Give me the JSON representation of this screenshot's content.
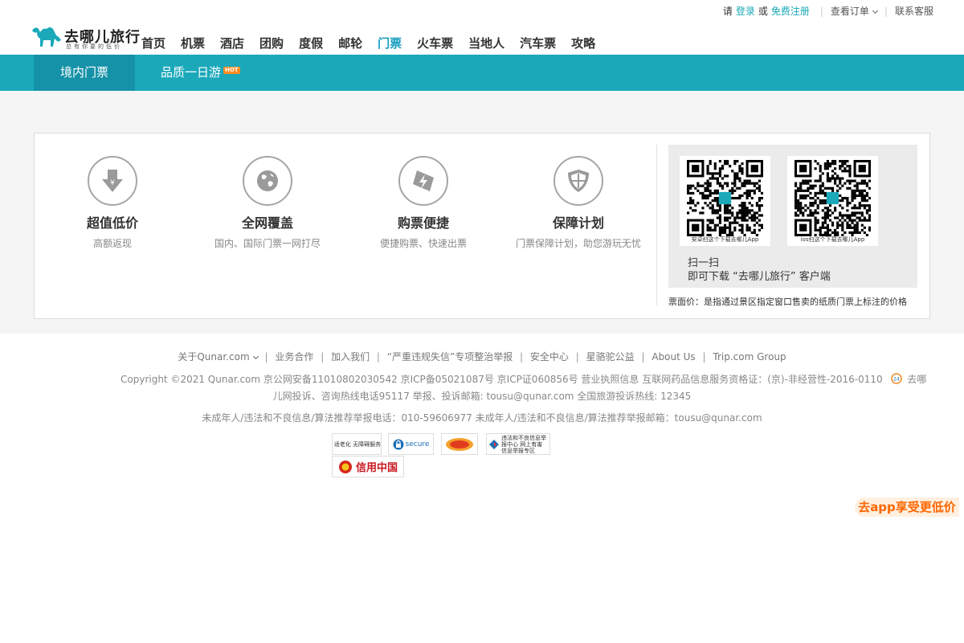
{
  "logo": {
    "name": "去哪儿旅行",
    "slogan": "总有你要的低价"
  },
  "main_nav": [
    "首页",
    "机票",
    "酒店",
    "团购",
    "度假",
    "邮轮",
    "门票",
    "火车票",
    "当地人",
    "汽车票",
    "攻略"
  ],
  "active_nav": "门票",
  "userbar": {
    "prefix": "请",
    "login": "登录",
    "or": "或",
    "register": "免费注册",
    "orders": "查看订单",
    "service": "联系客服"
  },
  "subnav": {
    "tab1": "境内门票",
    "tab2": "品质一日游",
    "tab2_badge": "HOT"
  },
  "features": [
    {
      "title": "超值低价",
      "desc": "高额返现",
      "icon": "yen-down-arrow-icon"
    },
    {
      "title": "全网覆盖",
      "desc": "国内、国际门票一网打尽",
      "icon": "globe-icon"
    },
    {
      "title": "购票便捷",
      "desc": "便捷购票、快速出票",
      "icon": "ticket-lightning-icon"
    },
    {
      "title": "保障计划",
      "desc": "门票保障计划，助您游玩无忧",
      "icon": "shield-icon"
    }
  ],
  "qr": {
    "android_caption": "安卓扫这个下载去哪儿App",
    "ios_caption": "ios扫这个下载去哪儿App",
    "scan": "扫一扫",
    "download": "即可下载 “去哪儿旅行” 客户端"
  },
  "price_note": "票面价：是指通过景区指定窗口售卖的纸质门票上标注的价格",
  "footer": {
    "links": [
      "关于Qunar.com",
      "业务合作",
      "加入我们",
      "“严重违规失信”专项整治举报",
      "安全中心",
      "星骆驼公益",
      "About Us",
      "Trip.com Group"
    ],
    "copyright_line1": "Copyright ©2021 Qunar.com  京公网安备11010802030542  京ICP备05021087号  京ICP证060856号  营业执照信息  互联网药品信息服务资格证：(京)-非经营性-2016-0110",
    "copyright_tail": "去哪",
    "copyright_line2": "儿网投诉、咨询热线电话95117  举报、投诉邮箱: tousu@qunar.com  全国旅游投诉热线: 12345",
    "copyright_line3": "未成年人/违法和不良信息/算法推荐举报电话：010-59606977  未成年人/违法和不良信息/算法推荐举报邮箱：tousu@qunar.com",
    "badges": [
      "适老化 无障碍服务",
      "secure",
      "",
      "违法和不良信息举报中心 网上有害信息举报专区",
      "信用中国"
    ]
  },
  "app_button": "去app享受更低价",
  "colors": {
    "brand": "#1ba9ba",
    "brand_dark": "#1592a8",
    "accent": "#ff6600"
  }
}
